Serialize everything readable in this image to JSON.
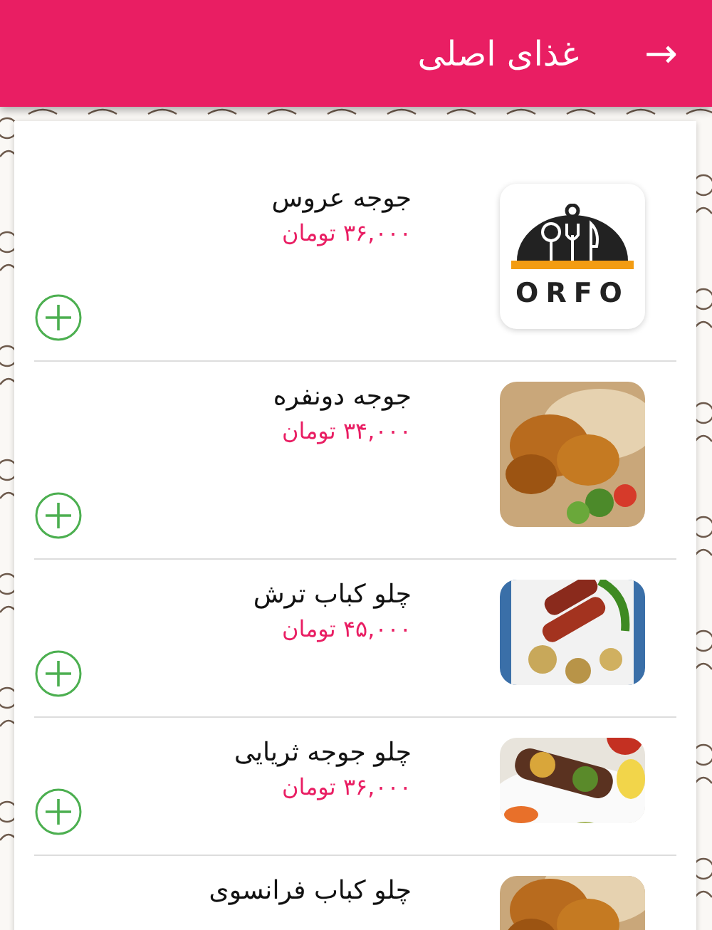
{
  "header": {
    "title": "غذای اصلی",
    "back_icon": "→"
  },
  "items": [
    {
      "name": "جوجه عروس",
      "price": "۳۶,۰۰۰ تومان",
      "image": {
        "kind": "logo",
        "text": "ORFO"
      }
    },
    {
      "name": "جوجه دونفره",
      "price": "۳۴,۰۰۰ تومان"
    },
    {
      "name": "چلو کباب ترش",
      "price": "۴۵,۰۰۰ تومان"
    },
    {
      "name": "چلو جوجه ثریایی",
      "price": "۳۶,۰۰۰ تومان"
    },
    {
      "name": "چلو کباب فرانسوی"
    }
  ]
}
